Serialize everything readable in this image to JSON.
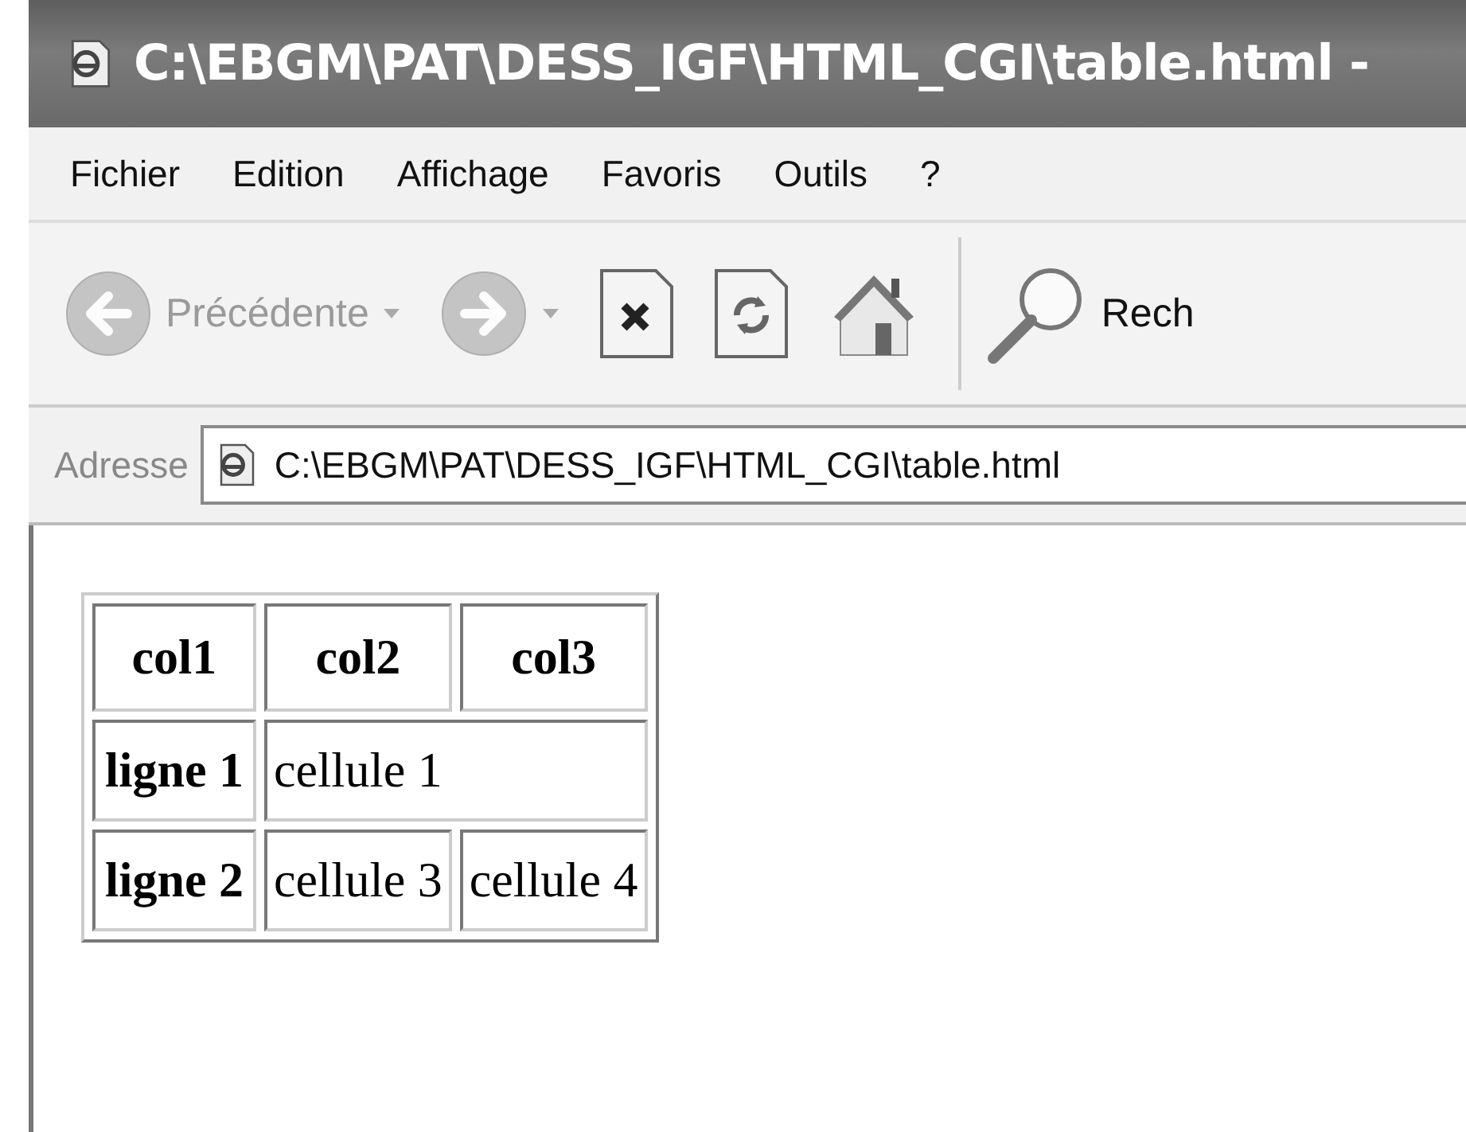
{
  "window": {
    "title": "C:\\EBGM\\PAT\\DESS_IGF\\HTML_CGI\\table.html -"
  },
  "menu": [
    "Fichier",
    "Edition",
    "Affichage",
    "Favoris",
    "Outils",
    "?"
  ],
  "toolbar": [
    {
      "kind": "back",
      "label": "Précédente",
      "disabled": true
    },
    {
      "kind": "forward",
      "disabled": true
    },
    {
      "kind": "stop",
      "disabled": false
    },
    {
      "kind": "refresh",
      "disabled": false
    },
    {
      "kind": "home",
      "disabled": false
    },
    {
      "kind": "search",
      "label": "Rech",
      "disabled": false
    }
  ],
  "address": {
    "label": "Adresse",
    "value": "C:\\EBGM\\PAT\\DESS_IGF\\HTML_CGI\\table.html"
  },
  "table": {
    "columns": [
      "col1",
      "col2",
      "col3"
    ],
    "rows": [
      {
        "cells": [
          {
            "text": "ligne 1",
            "header": true
          },
          {
            "text": "cellule 1",
            "colspan": 2
          }
        ]
      },
      {
        "cells": [
          {
            "text": "ligne 2",
            "header": true
          },
          {
            "text": "cellule 3"
          },
          {
            "text": "cellule 4"
          }
        ]
      }
    ]
  }
}
